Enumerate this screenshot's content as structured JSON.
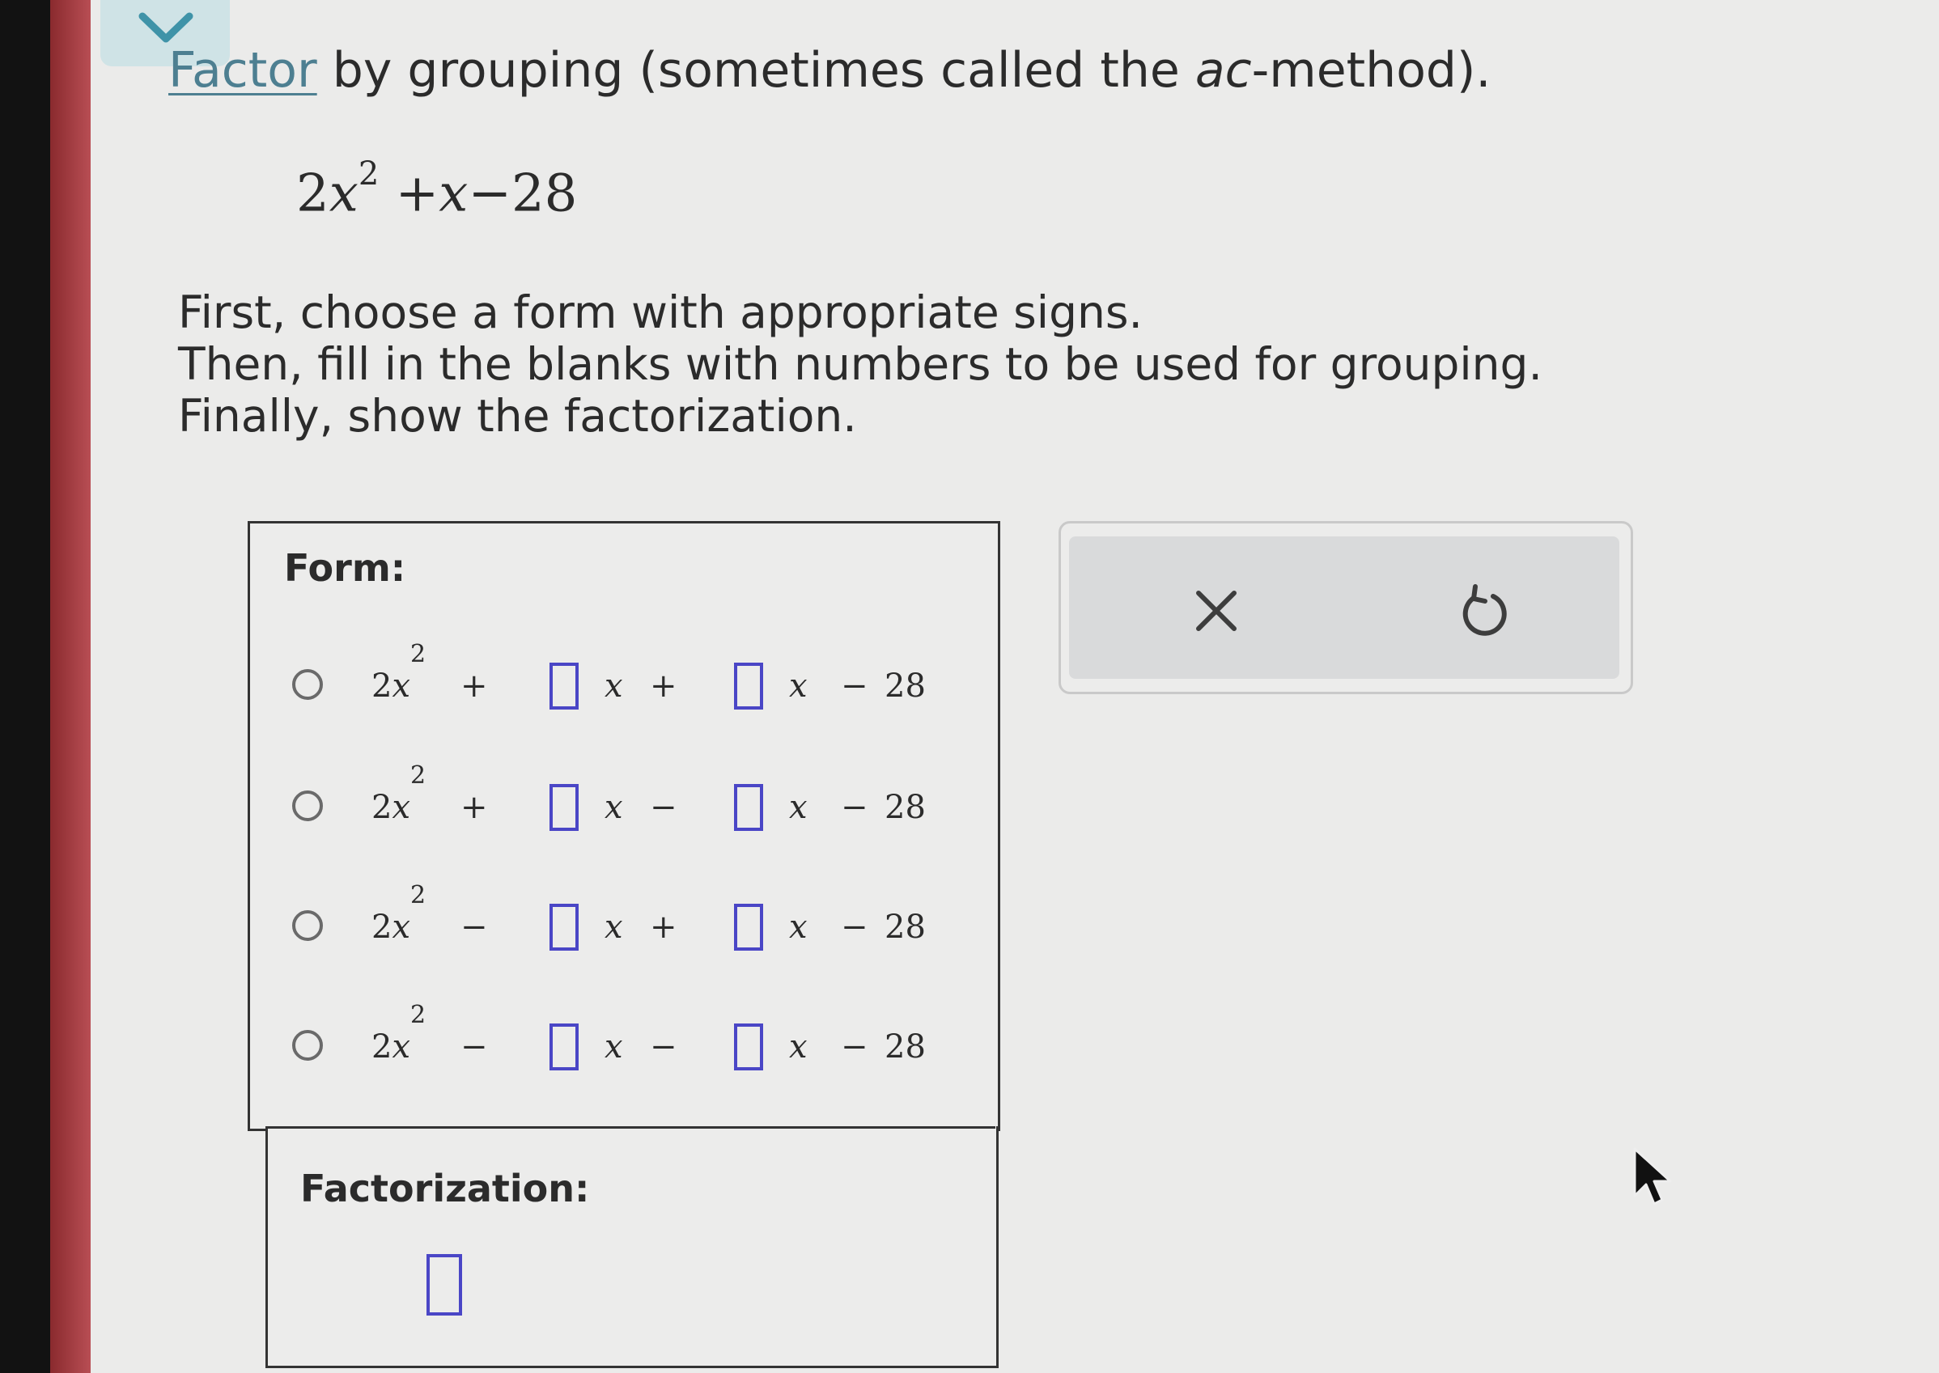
{
  "header": {
    "title_link": "Factor",
    "title_rest": " by grouping (sometimes called the ",
    "title_italic": "ac",
    "title_end": "-method)."
  },
  "expression": {
    "coef": "2",
    "var": "x",
    "exp": "2",
    "rest_plus": " +",
    "var2": "x",
    "rest_minus": "−28"
  },
  "instructions": [
    "First, choose a form with appropriate signs.",
    "Then, fill in the blanks with numbers to be used for grouping.",
    "Finally, show the factorization."
  ],
  "form": {
    "label": "Form:",
    "lead": "2",
    "var": "x",
    "exp": "2",
    "const": "28",
    "rows": [
      {
        "sign1": "+",
        "sign2": "+",
        "sign3": "−"
      },
      {
        "sign1": "+",
        "sign2": "−",
        "sign3": "−"
      },
      {
        "sign1": "−",
        "sign2": "+",
        "sign3": "−"
      },
      {
        "sign1": "−",
        "sign2": "−",
        "sign3": "−"
      }
    ]
  },
  "factorization": {
    "label": "Factorization:"
  },
  "icons": {
    "collapse": "chevron-down-icon",
    "clear": "close-icon",
    "undo": "undo-icon",
    "cursor": "mouse-cursor-icon"
  },
  "colors": {
    "blank_border": "#4a46c6",
    "link": "#4d7f91",
    "accent_strip": "#b84e54"
  }
}
